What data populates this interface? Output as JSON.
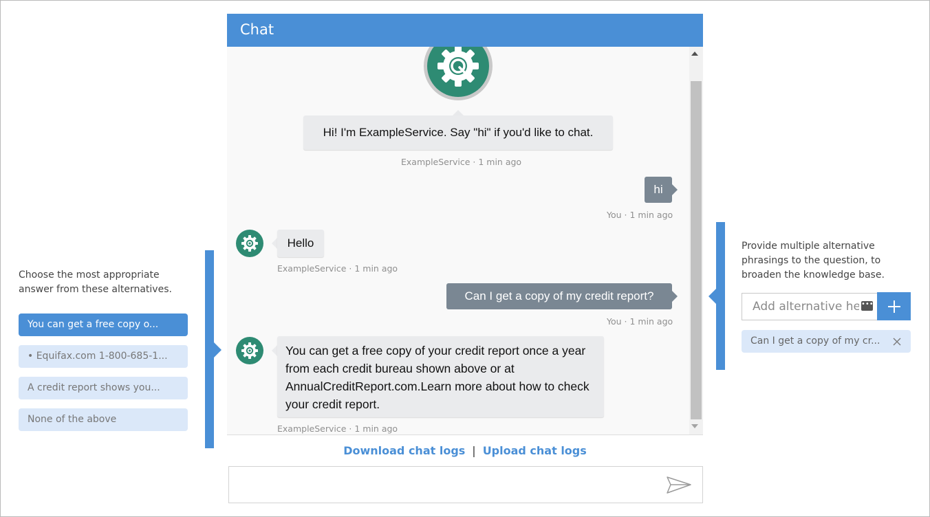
{
  "left_panel": {
    "description": "Choose the most appropriate answer from these alternatives.",
    "alternatives": [
      {
        "label": "You can get a free copy o..."
      },
      {
        "label": "• Equifax.com 1-800-685-1..."
      },
      {
        "label": "A credit report shows you..."
      },
      {
        "label": "None of the above"
      }
    ]
  },
  "right_panel": {
    "description": "Provide multiple alternative phrasings to the question, to broaden the knowledge base.",
    "input_placeholder": "Add alternative here",
    "add_icon": "plus-icon",
    "chips": [
      {
        "label": "Can I get a copy of my cr...",
        "close_icon": "close-icon"
      }
    ]
  },
  "chat": {
    "title": "Chat",
    "messages": [
      {
        "from": "bot",
        "text": "Hi! I'm ExampleService. Say \"hi\" if you'd like to chat.",
        "meta": "ExampleService · 1 min ago"
      },
      {
        "from": "user",
        "text": "hi",
        "meta": "You · 1 min ago"
      },
      {
        "from": "bot",
        "text": "Hello",
        "meta": "ExampleService · 1 min ago"
      },
      {
        "from": "user",
        "text": "Can I get a copy of my credit report?",
        "meta": "You · 1 min ago"
      },
      {
        "from": "bot",
        "text": "You can get a free copy of your credit report once a year from each credit bureau shown above or at AnnualCreditReport.com.Learn more about how to check your credit report.",
        "meta": "ExampleService · 1 min ago"
      }
    ],
    "footer": {
      "download_label": "Download chat logs",
      "separator": "|",
      "upload_label": "Upload chat logs"
    },
    "composer": {
      "placeholder": "",
      "send_icon": "send-icon"
    }
  },
  "colors": {
    "accent": "#4a8fd6",
    "bot_avatar": "#2e8b73",
    "user_bubble": "#7a8793",
    "bot_bubble": "#eaebed",
    "chip_bg": "#dbe8f9"
  }
}
